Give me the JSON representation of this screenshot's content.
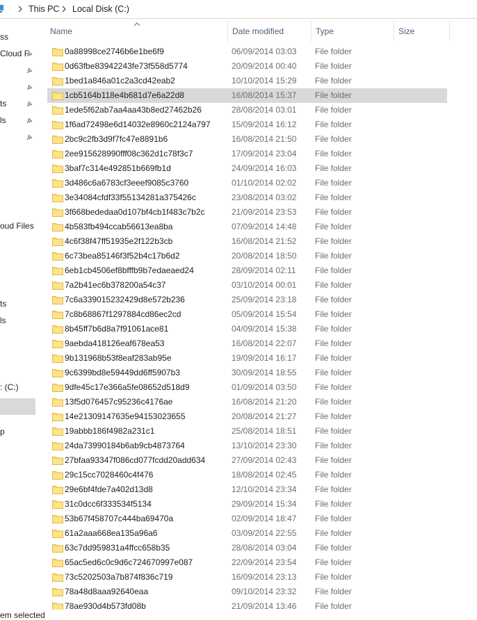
{
  "breadcrumb": [
    "This PC",
    "Local Disk (C:)"
  ],
  "navpane": {
    "items": [
      "ss",
      "Cloud F",
      "ts",
      "ls",
      "oud Files",
      "ts",
      "ls",
      ": (C:)",
      "p"
    ],
    "status": "em selected"
  },
  "columns": {
    "name": "Name",
    "date": "Date modified",
    "type": "Type",
    "size": "Size"
  },
  "files": [
    {
      "name": "0a88998ce2746b6e1be6f9",
      "date": "06/09/2014 03:03",
      "type": "File folder"
    },
    {
      "name": "0d63fbe83942243fe73f558d5774",
      "date": "20/09/2014 00:40",
      "type": "File folder"
    },
    {
      "name": "1bed1a846a01c2a3cd42eab2",
      "date": "10/10/2014 15:29",
      "type": "File folder"
    },
    {
      "name": "1cb5164b118e4b681d7e6a22d8",
      "date": "16/08/2014 15:37",
      "type": "File folder",
      "selected": true
    },
    {
      "name": "1ede5f62ab7aa4aa43b8ed27462b26",
      "date": "28/08/2014 03:01",
      "type": "File folder"
    },
    {
      "name": "1f6ad72498e6d14032e8960c2124a797",
      "date": "15/09/2014 16:12",
      "type": "File folder"
    },
    {
      "name": "2bc9c2fb3d9f7fc47e8891b6",
      "date": "16/08/2014 21:50",
      "type": "File folder"
    },
    {
      "name": "2ee915628990fff08c362d1c78f3c7",
      "date": "17/09/2014 23:04",
      "type": "File folder"
    },
    {
      "name": "3baf7c314e492851b669fb1d",
      "date": "24/09/2014 16:03",
      "type": "File folder"
    },
    {
      "name": "3d486c6a6783cf3eeef9085c3760",
      "date": "01/10/2014 02:02",
      "type": "File folder"
    },
    {
      "name": "3e34084cfdf33f55134281a375426c",
      "date": "23/08/2014 03:02",
      "type": "File folder"
    },
    {
      "name": "3f668bededaa0d107bf4cb1f483c7b2c",
      "date": "21/09/2014 23:53",
      "type": "File folder"
    },
    {
      "name": "4b583fb494ccab56613ea8ba",
      "date": "07/09/2014 14:48",
      "type": "File folder"
    },
    {
      "name": "4c6f38f47ff51935e2f122b3cb",
      "date": "16/08/2014 21:52",
      "type": "File folder"
    },
    {
      "name": "6c73bea85146f3f52b4c17b6d2",
      "date": "20/08/2014 18:50",
      "type": "File folder"
    },
    {
      "name": "6eb1cb4506ef8bfffb9b7edaeaed24",
      "date": "28/09/2014 02:11",
      "type": "File folder"
    },
    {
      "name": "7a2b41ec6b378200a54c37",
      "date": "03/10/2014 00:01",
      "type": "File folder"
    },
    {
      "name": "7c6a339015232429d8e572b236",
      "date": "25/09/2014 23:18",
      "type": "File folder"
    },
    {
      "name": "7c8b68867f1297884cd86ec2cd",
      "date": "05/09/2014 15:54",
      "type": "File folder"
    },
    {
      "name": "8b45ff7b6d8a7f91061ace81",
      "date": "04/09/2014 15:38",
      "type": "File folder"
    },
    {
      "name": "9aebda418126eaf678ea53",
      "date": "16/08/2014 22:07",
      "type": "File folder"
    },
    {
      "name": "9b131968b53f8eaf283ab95e",
      "date": "19/09/2014 16:17",
      "type": "File folder"
    },
    {
      "name": "9c6399bd8e59449dd6ff5907b3",
      "date": "30/09/2014 18:55",
      "type": "File folder"
    },
    {
      "name": "9dfe45c17e366a5fe08652d518d9",
      "date": "01/09/2014 03:50",
      "type": "File folder"
    },
    {
      "name": "13f5d076457c95236c4176ae",
      "date": "16/08/2014 21:20",
      "type": "File folder"
    },
    {
      "name": "14e21309147635e94153023655",
      "date": "20/08/2014 21:27",
      "type": "File folder"
    },
    {
      "name": "19abbb186f4982a231c1",
      "date": "25/08/2014 18:51",
      "type": "File folder"
    },
    {
      "name": "24da73990184b6ab9cb4873764",
      "date": "13/10/2014 23:30",
      "type": "File folder"
    },
    {
      "name": "27bfaa93347f086cd077fcdd20add634",
      "date": "27/09/2014 02:43",
      "type": "File folder"
    },
    {
      "name": "29c15cc7028460c4f476",
      "date": "18/08/2014 02:45",
      "type": "File folder"
    },
    {
      "name": "29e6bf4fde7a402d13d8",
      "date": "12/10/2014 23:34",
      "type": "File folder"
    },
    {
      "name": "31c0dcc6f333534f5134",
      "date": "29/09/2014 15:34",
      "type": "File folder"
    },
    {
      "name": "53b67f458707c444ba69470a",
      "date": "02/09/2014 18:47",
      "type": "File folder"
    },
    {
      "name": "61a2aaa668ea135a96a6",
      "date": "03/09/2014 22:55",
      "type": "File folder"
    },
    {
      "name": "63c7dd959831a4ffcc658b35",
      "date": "28/08/2014 03:04",
      "type": "File folder"
    },
    {
      "name": "65ac5ed6c0c9d6c724670997e087",
      "date": "22/09/2014 23:54",
      "type": "File folder"
    },
    {
      "name": "73c5202503a7b874f836c719",
      "date": "16/09/2014 23:13",
      "type": "File folder"
    },
    {
      "name": "78a48d8aaa92640eaa",
      "date": "09/10/2014 23:32",
      "type": "File folder"
    },
    {
      "name": "78ae930d4b573fd08b",
      "date": "21/09/2014 13:46",
      "type": "File folder"
    }
  ]
}
